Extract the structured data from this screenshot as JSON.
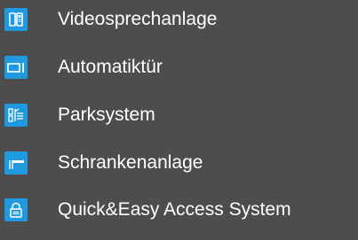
{
  "menu": {
    "accent_color": "#1f9ae0",
    "background_color": "#4d4d4d",
    "items": [
      {
        "icon": "video-intercom-icon",
        "label": "Videosprechanlage"
      },
      {
        "icon": "automatic-door-icon",
        "label": "Automatiktür"
      },
      {
        "icon": "parking-system-icon",
        "label": "Parksystem"
      },
      {
        "icon": "barrier-gate-icon",
        "label": "Schrankenanlage"
      },
      {
        "icon": "lock-icon",
        "label": "Quick&Easy Access System"
      }
    ]
  }
}
